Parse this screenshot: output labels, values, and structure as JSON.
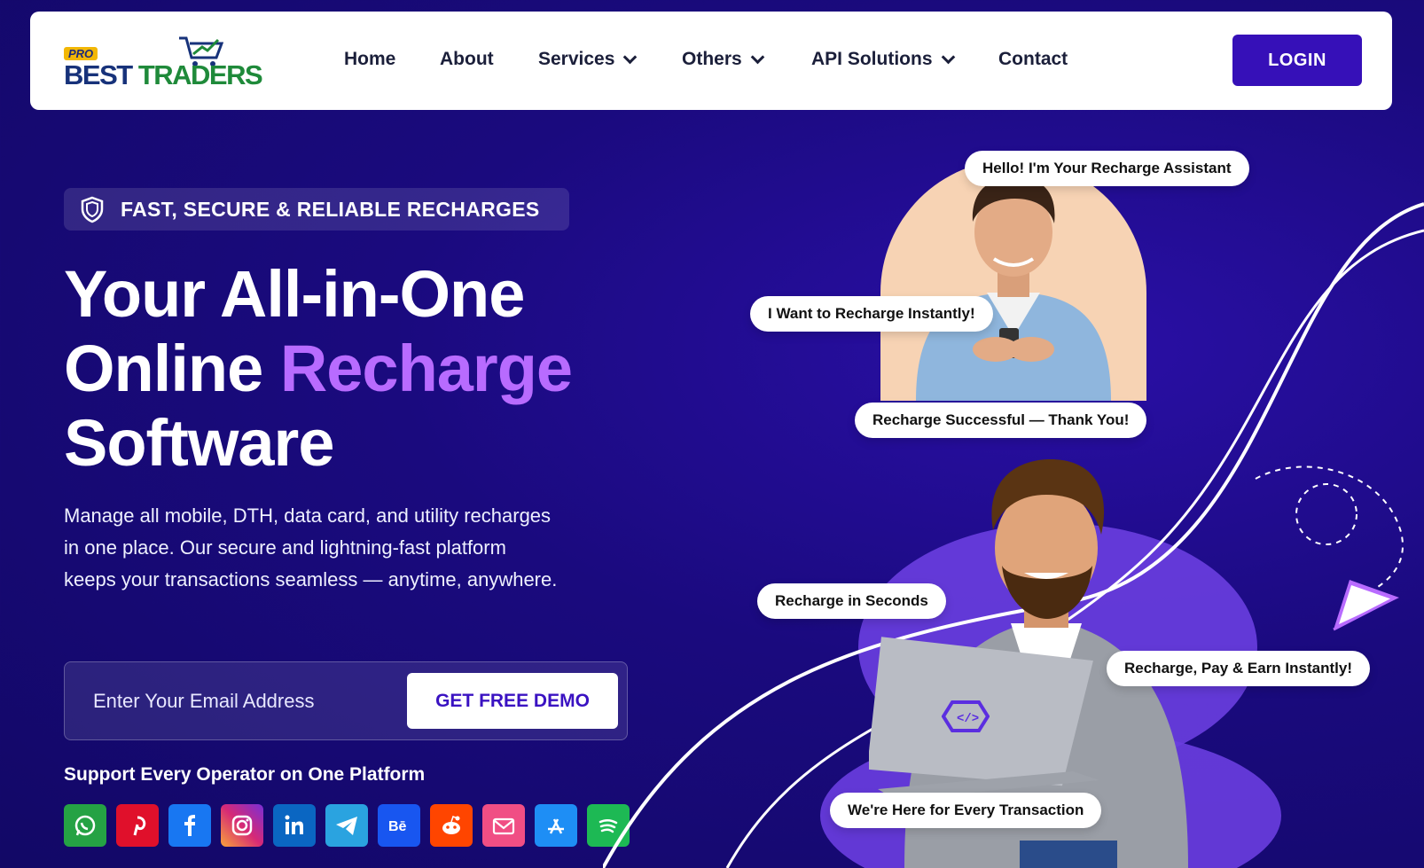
{
  "nav": {
    "logo_pro": "PRO",
    "logo_best": "BEST",
    "logo_traders": "TRADERS",
    "items": [
      {
        "label": "Home",
        "dropdown": false
      },
      {
        "label": "About",
        "dropdown": false
      },
      {
        "label": "Services",
        "dropdown": true
      },
      {
        "label": "Others",
        "dropdown": true
      },
      {
        "label": "API Solutions",
        "dropdown": true
      },
      {
        "label": "Contact",
        "dropdown": false
      }
    ],
    "login_label": "LOGIN"
  },
  "hero": {
    "badge": "FAST, SECURE & RELIABLE RECHARGES",
    "headline_line1": "Your All-in-One",
    "headline_line2_a": "Online ",
    "headline_line2_b": "Recharge",
    "headline_line3": "Software",
    "description": "Manage all mobile, DTH, data card, and utility recharges in one place. Our secure and lightning-fast platform keeps your transactions seamless — anytime, anywhere.",
    "email_placeholder": "Enter Your Email Address",
    "demo_label": "GET FREE DEMO",
    "support_title": "Support Every Operator on One Platform"
  },
  "socials": [
    {
      "icon": "whatsapp-icon",
      "color": "#25a244"
    },
    {
      "icon": "pinterest-icon",
      "color": "#e0102b"
    },
    {
      "icon": "facebook-icon",
      "color": "#1877f2"
    },
    {
      "icon": "instagram-icon",
      "color": "#d62976"
    },
    {
      "icon": "linkedin-icon",
      "color": "#0a66c2"
    },
    {
      "icon": "telegram-icon",
      "color": "#2aa3e0"
    },
    {
      "icon": "behance-icon",
      "color": "#1856f0"
    },
    {
      "icon": "reddit-icon",
      "color": "#ff4500"
    },
    {
      "icon": "mail-icon",
      "color": "#f04e84"
    },
    {
      "icon": "appstore-icon",
      "color": "#1e8ef5"
    },
    {
      "icon": "spotify-icon",
      "color": "#1db954"
    }
  ],
  "bubbles": {
    "b1": "Hello! I'm Your Recharge Assistant",
    "b2": "I Want to Recharge Instantly!",
    "b3": "Recharge Successful — Thank You!",
    "b4": "Recharge in Seconds",
    "b5": "Recharge, Pay & Earn Instantly!",
    "b6": "We're Here for Every Transaction"
  },
  "colors": {
    "background": "#1a0a7e",
    "accent": "#b86bff",
    "button": "#3610b8",
    "blob": "#6a3ee0"
  }
}
